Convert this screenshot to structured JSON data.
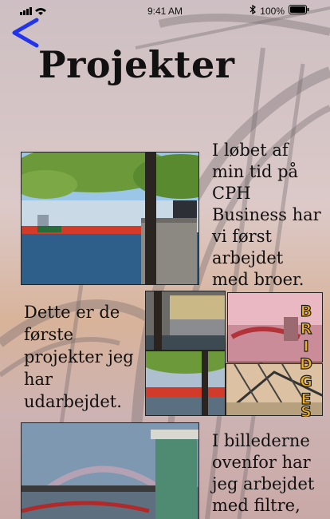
{
  "status_bar": {
    "time": "9:41 AM",
    "battery": "100%"
  },
  "header": {
    "title": "Projekter",
    "back_icon": "chevron-left-icon"
  },
  "sections": [
    {
      "text": "I løbet af min tid på CPH Business har vi først arbejdet med broer."
    },
    {
      "text": "Dette er de første projekter jeg har udarbejdet.",
      "collage_label": "BRIDGES"
    },
    {
      "text": "I billederne ovenfor har jeg arbejdet med filtre,"
    }
  ],
  "colors": {
    "accent": "#2233ee",
    "bridge_red": "#d23a2a",
    "sign_yellow": "#f2b21a"
  }
}
